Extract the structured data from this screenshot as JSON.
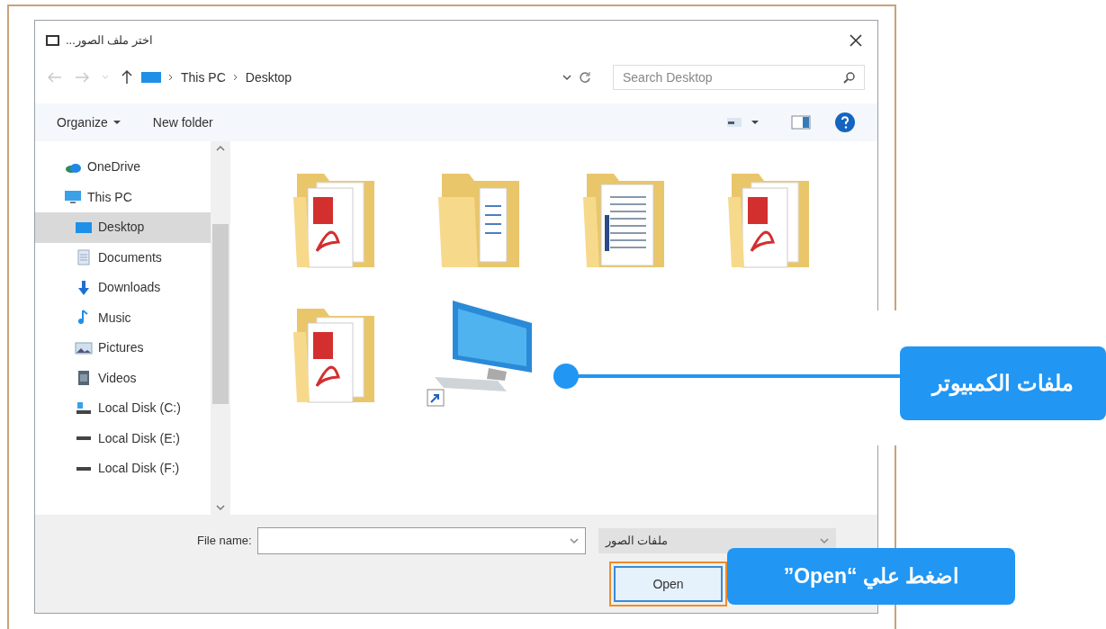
{
  "dialog": {
    "title": "اختر ملف الصور...",
    "address": {
      "path": [
        "This PC",
        "Desktop"
      ]
    },
    "search": {
      "placeholder": "Search Desktop"
    },
    "toolbar": {
      "organize": "Organize",
      "new_folder": "New folder"
    },
    "nav": [
      {
        "label": "OneDrive",
        "kind": "cloud",
        "selected": false
      },
      {
        "label": "This PC",
        "kind": "pc",
        "selected": false,
        "children": [
          {
            "label": "Desktop",
            "kind": "desktop",
            "selected": true
          },
          {
            "label": "Documents",
            "kind": "documents",
            "selected": false
          },
          {
            "label": "Downloads",
            "kind": "downloads",
            "selected": false
          },
          {
            "label": "Music",
            "kind": "music",
            "selected": false
          },
          {
            "label": "Pictures",
            "kind": "pictures",
            "selected": false
          },
          {
            "label": "Videos",
            "kind": "videos",
            "selected": false
          },
          {
            "label": "Local Disk (C:)",
            "kind": "system-disk",
            "selected": false
          },
          {
            "label": "Local Disk (E:)",
            "kind": "disk",
            "selected": false
          },
          {
            "label": "Local Disk (F:)",
            "kind": "disk",
            "selected": false
          }
        ]
      }
    ],
    "items": [
      {
        "kind": "pdf-folder"
      },
      {
        "kind": "doc-folder"
      },
      {
        "kind": "list-folder"
      },
      {
        "kind": "pdf-folder"
      },
      {
        "kind": "pdf-folder"
      },
      {
        "kind": "computer-shortcut"
      }
    ],
    "file_name": {
      "label": "File name:"
    },
    "file_type": "ملفات الصور",
    "open_button": "Open"
  },
  "callouts": [
    {
      "text": "ملفات الكمبيوتر"
    },
    {
      "text": "اضغط علي “Open”"
    }
  ]
}
